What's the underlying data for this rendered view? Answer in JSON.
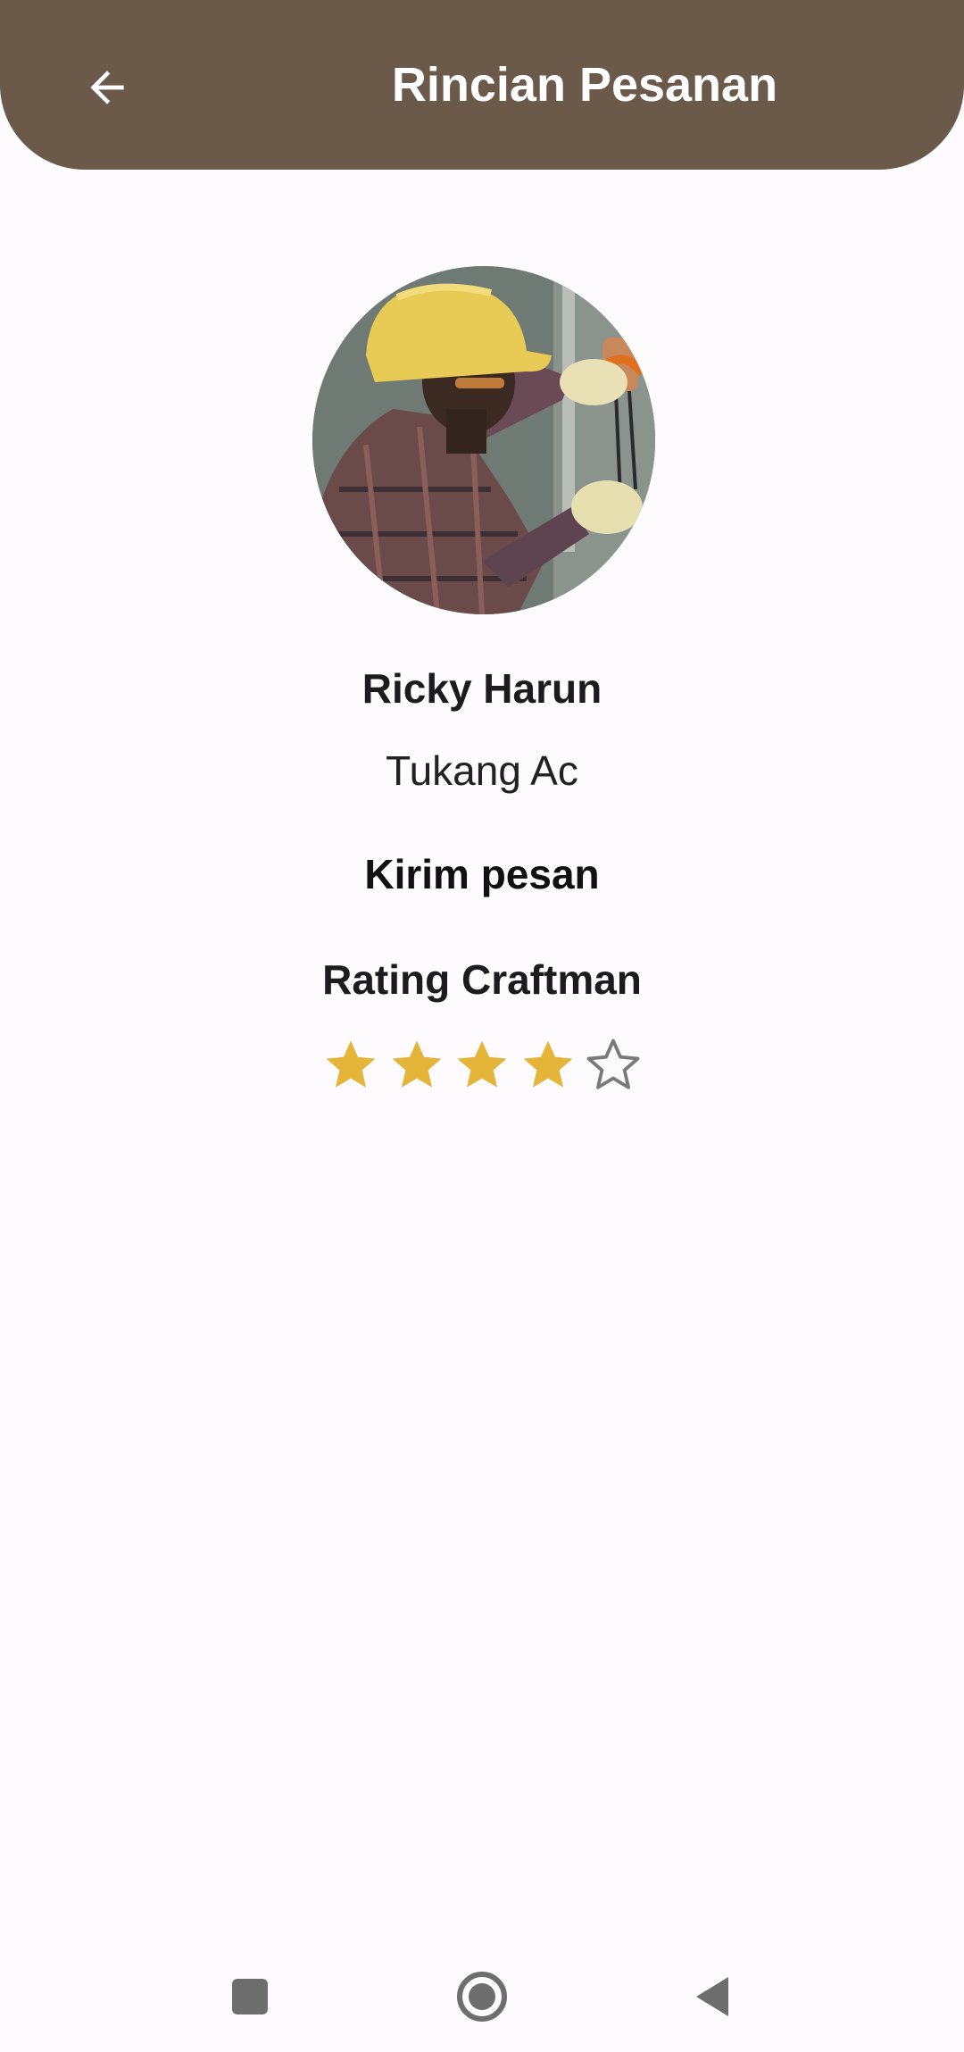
{
  "header": {
    "title": "Rincian Pesanan",
    "back_icon": "arrow-left-icon"
  },
  "profile": {
    "avatar_description": "craftsman-photo",
    "name": "Ricky Harun",
    "role": "Tukang Ac",
    "message_label": "Kirim pesan"
  },
  "rating": {
    "title": "Rating Craftman",
    "value": 4,
    "max": 5,
    "filled_color": "#e5b53a",
    "empty_color": "#7a7a7a"
  },
  "nav": {
    "recents_icon": "square-icon",
    "home_icon": "circle-home-icon",
    "back_icon": "triangle-back-icon"
  },
  "colors": {
    "app_bar": "#6b5a4a",
    "background": "#fdfbfd"
  }
}
